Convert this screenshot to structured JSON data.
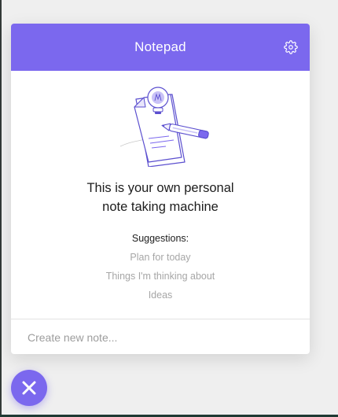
{
  "notepad": {
    "title": "Notepad",
    "settings_icon": "gear-icon",
    "accent_color": "#7b68ee",
    "illustration": "lightbulb-document-pencil-illustration",
    "headline_line1": "This is your own personal",
    "headline_line2": "note taking machine",
    "suggestions_title": "Suggestions:",
    "suggestions": [
      "Plan for today",
      "Things I'm thinking about",
      "Ideas"
    ],
    "new_note_placeholder": "Create new note..."
  },
  "fab": {
    "icon": "close-icon"
  }
}
